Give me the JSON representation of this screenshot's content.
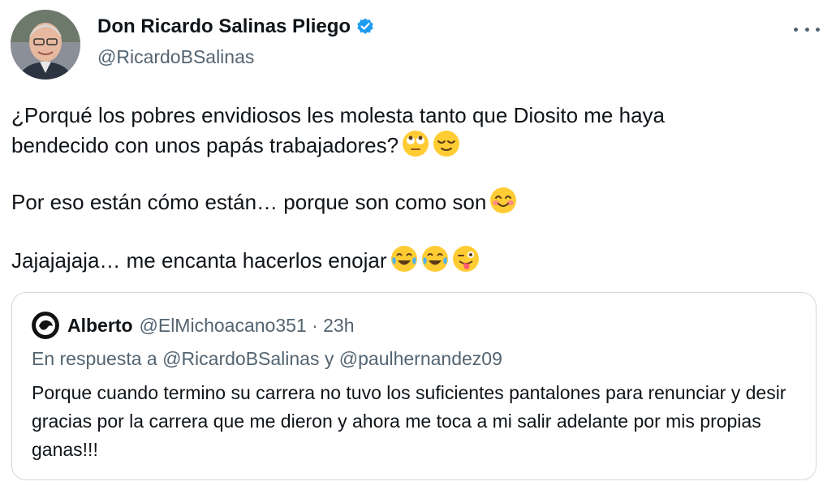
{
  "tweet": {
    "display_name": "Don Ricardo Salinas Pliego",
    "handle": "@RicardoBSalinas",
    "verified_icon": "verified-badge-icon",
    "more_icon": "more-options-icon",
    "para1_line1": "¿Porqué los pobres envidiosos les molesta tanto que Diosito me haya",
    "para1_line2": "bendecido con unos papás trabajadores?",
    "para2": "Por eso están cómo están… porque son como son",
    "para3": "Jajajajaja… me encanta hacerlos enojar",
    "emojis": [
      "face-with-rolling-eyes",
      "relieved-face",
      "smiling-face-with-smiling-eyes",
      "face-with-tears-of-joy",
      "face-with-tears-of-joy",
      "winking-face-with-tongue"
    ]
  },
  "quote": {
    "display_name": "Alberto",
    "meta": "@ElMichoacano351 · 23h",
    "reply_context": "En respuesta a @RicardoBSalinas y @paulhernandez09",
    "text": "Porque cuando termino su carrera no tuvo los suficientes pantalones para renunciar y desir gracias por la carrera que me dieron y ahora me toca a mi salir adelante por mis propias ganas!!!"
  },
  "colors": {
    "text": "#0f1419",
    "secondary": "#536471",
    "verified": "#1d9bf0",
    "border": "#cfd9de",
    "emoji": "#ffcc33"
  }
}
